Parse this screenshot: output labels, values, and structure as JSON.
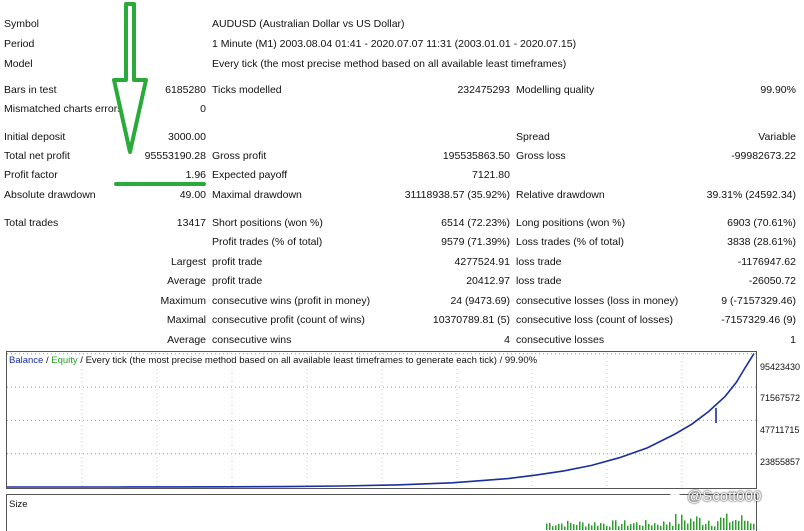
{
  "report": {
    "symbol": {
      "label": "Symbol",
      "value": "AUDUSD (Australian Dollar vs US Dollar)"
    },
    "period": {
      "label": "Period",
      "value": "1 Minute (M1) 2003.08.04 01:41 - 2020.07.07 11:31 (2003.01.01 - 2020.07.15)"
    },
    "model": {
      "label": "Model",
      "value": "Every tick (the most precise method based on all available least timeframes)"
    },
    "bars_in_test": {
      "label": "Bars in test",
      "value": "6185280"
    },
    "ticks_modelled": {
      "label": "Ticks modelled",
      "value": "232475293"
    },
    "modelling_quality": {
      "label": "Modelling quality",
      "value": "99.90%"
    },
    "mismatched_errors": {
      "label": "Mismatched charts errors",
      "value": "0"
    },
    "initial_deposit": {
      "label": "Initial deposit",
      "value": "3000.00"
    },
    "spread": {
      "label": "Spread",
      "value": "Variable"
    },
    "total_net_profit": {
      "label": "Total net profit",
      "value": "95553190.28"
    },
    "gross_profit": {
      "label": "Gross profit",
      "value": "195535863.50"
    },
    "gross_loss": {
      "label": "Gross loss",
      "value": "-99982673.22"
    },
    "profit_factor": {
      "label": "Profit factor",
      "value": "1.96"
    },
    "expected_payoff": {
      "label": "Expected payoff",
      "value": "7121.80"
    },
    "absolute_drawdown": {
      "label": "Absolute drawdown",
      "value": "49.00"
    },
    "maximal_drawdown": {
      "label": "Maximal drawdown",
      "value": "31118938.57 (35.92%)"
    },
    "relative_drawdown": {
      "label": "Relative drawdown",
      "value": "39.31% (24592.34)"
    },
    "total_trades": {
      "label": "Total trades",
      "value": "13417"
    },
    "short_positions": {
      "label": "Short positions (won %)",
      "value": "6514 (72.23%)"
    },
    "long_positions": {
      "label": "Long positions (won %)",
      "value": "6903 (70.61%)"
    },
    "profit_trades": {
      "label": "Profit trades (% of total)",
      "value": "9579 (71.39%)"
    },
    "loss_trades": {
      "label": "Loss trades (% of total)",
      "value": "3838 (28.61%)"
    },
    "largest": {
      "label": "Largest",
      "profit_label": "profit trade",
      "profit_value": "4277524.91",
      "loss_label": "loss trade",
      "loss_value": "-1176947.62"
    },
    "average": {
      "label": "Average",
      "profit_label": "profit trade",
      "profit_value": "20412.97",
      "loss_label": "loss trade",
      "loss_value": "-26050.72"
    },
    "maximum": {
      "label": "Maximum",
      "wins_label": "consecutive wins (profit in money)",
      "wins_value": "24 (9473.69)",
      "losses_label": "consecutive losses (loss in money)",
      "losses_value": "9 (-7157329.46)"
    },
    "maximal": {
      "label": "Maximal",
      "profit_label": "consecutive profit (count of wins)",
      "profit_value": "10370789.81 (5)",
      "loss_label": "consecutive loss (count of losses)",
      "loss_value": "-7157329.46 (9)"
    },
    "average_consec": {
      "label": "Average",
      "wins_label": "consecutive wins",
      "wins_value": "4",
      "losses_label": "consecutive losses",
      "losses_value": "1"
    }
  },
  "chart": {
    "legend_balance": "Balance",
    "legend_sep": " / ",
    "legend_equity": "Equity",
    "legend_rest": " / Every tick (the most precise method based on all available least timeframes to generate each tick) / 99.90%",
    "size_label": "Size",
    "y_ticks": [
      "95423430",
      "71567572",
      "47711715",
      "23855857"
    ]
  },
  "watermark": "@Scott000",
  "colors": {
    "balance": "#1a2fa0",
    "equity": "#2aa02a",
    "annotation": "#2aaa3a"
  },
  "chart_data": {
    "type": "line",
    "title": "",
    "xlabel": "",
    "ylabel": "",
    "ylim": [
      0,
      96000000
    ],
    "y_ticks": [
      95423430,
      71567572,
      47711715,
      23855857
    ],
    "x": [
      0,
      1000,
      2000,
      3000,
      4000,
      5000,
      6000,
      7000,
      8000,
      9000,
      9500,
      10000,
      10500,
      11000,
      11500,
      12000,
      12300,
      12600,
      12900,
      13100,
      13250,
      13417
    ],
    "series": [
      {
        "name": "Balance",
        "values": [
          3000,
          8000,
          20000,
          50000,
          120000,
          300000,
          700000,
          1500000,
          3000000,
          6000000,
          8500000,
          11500000,
          15500000,
          21000000,
          28000000,
          38000000,
          45000000,
          54000000,
          65000000,
          75000000,
          85000000,
          95553190
        ]
      }
    ]
  }
}
